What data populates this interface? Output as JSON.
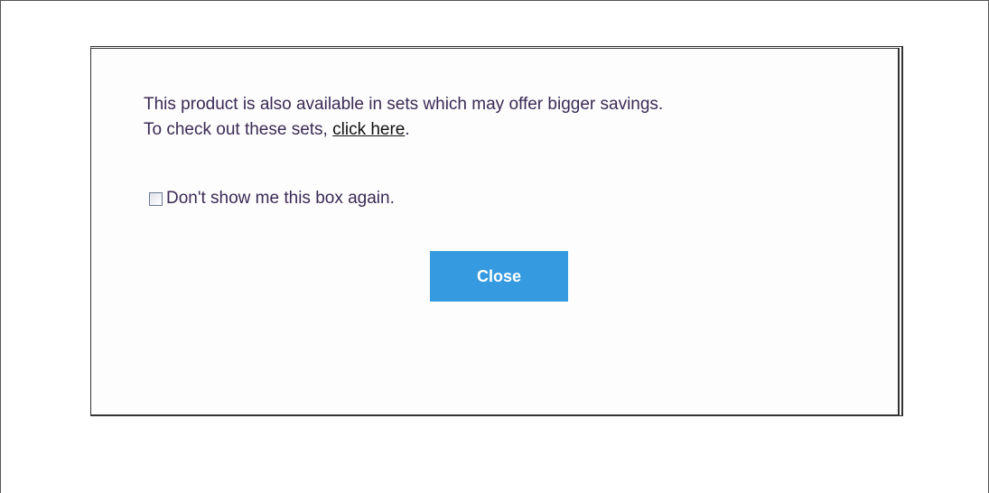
{
  "dialog": {
    "message_line1": "This product is also available in sets which may offer bigger savings.",
    "message_line2_prefix": "To check out these sets, ",
    "link_text": "click here",
    "message_line2_suffix": ".",
    "checkbox_label": "Don't show me this box again.",
    "checkbox_checked": false,
    "close_label": "Close",
    "colors": {
      "button_background": "#359ae0",
      "button_text": "#ffffff",
      "message_text": "#3a2a55"
    }
  }
}
